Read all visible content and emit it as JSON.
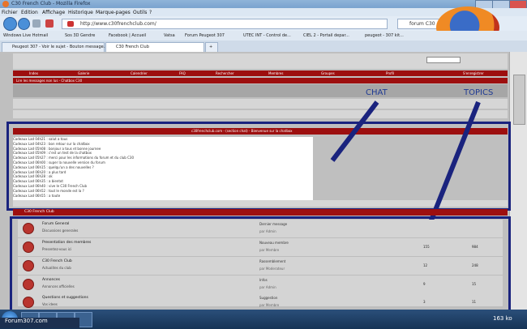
{
  "window": {
    "title": "C30 French Club - Mozilla Firefox"
  },
  "menu": [
    "Fichier",
    "Edition",
    "Affichage",
    "Historique",
    "Marque-pages",
    "Outils",
    "?"
  ],
  "address": {
    "url": "http://www.c30frenchclub.com/",
    "search_placeholder": "forum C30"
  },
  "bookmarks": [
    "Windows Live Hotmail",
    "Sos 3D Gendre",
    "Facebook | Accueil",
    "Vatsa",
    "Forum Peugeot 307",
    "UTEC INT - Control de...",
    "CIEL 2 - Portail depar...",
    "peugeot - 307 kit..."
  ],
  "tabs": [
    {
      "label": "Peugeot 307 - Voir le sujet - Bouton message...",
      "active": false
    },
    {
      "label": "C30 French Club",
      "active": true
    },
    {
      "label": "+",
      "active": false
    }
  ],
  "nav_items": [
    "Index",
    "Galerie",
    "Calendrier",
    "FAQ",
    "Rechercher",
    "Membres",
    "Groupes",
    "Profil",
    "S'enregistrer",
    "Connexion"
  ],
  "chat": {
    "header": "Lire les messages non lus - Chatbox C30",
    "banner": "c30frenchclub.com - (section chat) - Bienvenue sur la chatbox",
    "lines": [
      "Cadeaux Lad 04h21 : salut a tous",
      "Cadeaux Lad 04h23 : bon retour sur la chatbox",
      "Cadeaux Lad 05h08 : bonjour a tous et bonne journee",
      "Cadeaux Lad 05h09 : c'est un test de la chatbox",
      "Cadeaux Lad 05h27 : merci pour les informations du forum et du club C30",
      "Cadeaux Lad 06h00 : super la nouvelle version du forum",
      "Cadeaux Lad 06h15 : quelqu'un a des nouvelles ?",
      "Cadeaux Lad 06h20 : a plus tard",
      "Cadeaux Lad 06h28 : ok",
      "Cadeaux Lad 06h35 : a bientot",
      "Cadeaux Lad 06h40 : vive le C30 French Club",
      "Cadeaux Lad 06h52 : tout le monde est la ?",
      "Cadeaux Lad 06h55 : a toute",
      "Cadeaux Lad 07h01 : bye"
    ]
  },
  "annotations": {
    "chat": "CHAT",
    "topics": "TOPICS"
  },
  "forum": {
    "header": "C30 French Club",
    "rows": [
      {
        "title": "Forum General",
        "desc": "Discussions generales",
        "last": "Dernier message",
        "last2": "par Admin",
        "topics": "",
        "posts": ""
      },
      {
        "title": "Presentation des membres",
        "desc": "Presentez-vous ici",
        "last": "Nouveau membre",
        "last2": "par Membre",
        "topics": "155",
        "posts": "984"
      },
      {
        "title": "C30 French Club",
        "desc": "Actualites du club",
        "last": "Rassemblement",
        "last2": "par Moderateur",
        "topics": "12",
        "posts": "248"
      },
      {
        "title": "Annonces",
        "desc": "Annonces officielles",
        "last": "Infos",
        "last2": "par Admin",
        "topics": "9",
        "posts": "15"
      },
      {
        "title": "Questions et suggestions",
        "desc": "Vos idees",
        "last": "Suggestion",
        "last2": "par Membre",
        "topics": "3",
        "posts": "11"
      }
    ]
  },
  "taskbar": {
    "item": "Forum307.com",
    "clock": "163 ko"
  }
}
